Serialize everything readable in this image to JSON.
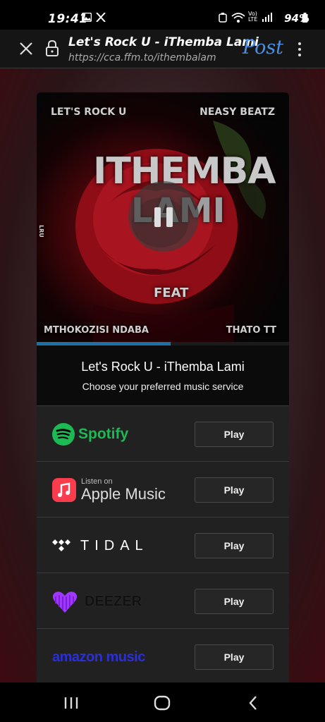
{
  "status_bar": {
    "time": "19:41",
    "battery": "94%",
    "icons": [
      "gallery-icon",
      "x-logo-icon",
      "alarm-icon",
      "wifi-icon",
      "volte-icon",
      "signal-icon",
      "battery-icon"
    ],
    "network_label": "Vo) LTE"
  },
  "browser": {
    "title": "Let's Rock U - iThemba Lami",
    "url": "https://cca.ffm.to/ithembalam",
    "post_label": "Post"
  },
  "cover": {
    "artist": "LET'S ROCK U",
    "producer": "NEASY BEATZ",
    "title_line1": "ITHEMBA",
    "title_line2": "LAMI",
    "feat_label": "FEAT",
    "featured_1": "MTHOKOZISI NDABA",
    "featured_2": "THATO TT",
    "side_text": "LRU"
  },
  "player": {
    "progress_fraction": 0.53,
    "accent_color": "#1e6fa3"
  },
  "info": {
    "title": "Let's Rock U - iThemba Lami",
    "subtitle": "Choose your preferred music service"
  },
  "services": [
    {
      "name": "Spotify",
      "button": "Play",
      "color": "#1db954"
    },
    {
      "name": "Apple Music",
      "prefix": "Listen on",
      "button": "Play",
      "color": "#fa3c4c"
    },
    {
      "name": "TIDAL",
      "button": "Play",
      "color": "#ffffff"
    },
    {
      "name": "DEEZER",
      "button": "Play",
      "color": "#a238ff"
    },
    {
      "name": "amazon music",
      "button": "Play",
      "color": "#2a2fd6"
    }
  ]
}
